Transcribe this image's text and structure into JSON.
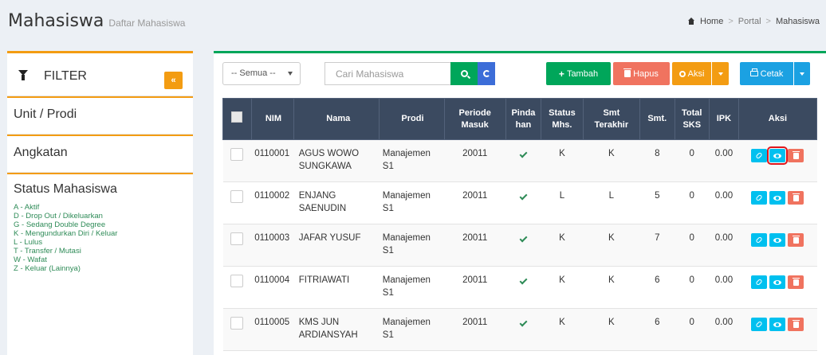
{
  "header": {
    "title": "Mahasiswa",
    "subtitle": "Daftar Mahasiswa"
  },
  "breadcrumb": [
    "Home",
    "Portal",
    "Mahasiswa"
  ],
  "filter": {
    "title": "FILTER",
    "collapse_label": "«",
    "items": [
      "Unit / Prodi",
      "Angkatan"
    ],
    "status_title": "Status Mahasiswa",
    "status_list": [
      "A - Aktif",
      "D - Drop Out / Dikeluarkan",
      "G - Sedang Double Degree",
      "K - Mengundurkan Diri / Keluar",
      "L - Lulus",
      "T - Transfer / Mutasi",
      "W - Wafat",
      "Z - Keluar (Lainnya)"
    ]
  },
  "toolbar": {
    "select_value": "-- Semua --",
    "search_placeholder": "Cari Mahasiswa",
    "tambah_label": "Tambah",
    "hapus_label": "Hapus",
    "aksi_label": "Aksi",
    "cetak_label": "Cetak"
  },
  "table": {
    "headers": {
      "nim": "NIM",
      "nama": "Nama",
      "prodi": "Prodi",
      "periode_1": "Periode",
      "periode_2": "Masuk",
      "pindahan_1": "Pinda",
      "pindahan_2": "han",
      "status_1": "Status",
      "status_2": "Mhs.",
      "smt_terakhir_1": "Smt",
      "smt_terakhir_2": "Terakhir",
      "smt": "Smt.",
      "total_sks_1": "Total",
      "total_sks_2": "SKS",
      "ipk": "IPK",
      "aksi": "Aksi"
    },
    "rows": [
      {
        "nim": "0110001",
        "nama_1": "AGUS WOWO",
        "nama_2": "SUNGKAWA",
        "prodi_1": "Manajemen",
        "prodi_2": "S1",
        "periode": "20011",
        "status": "K",
        "smt_terakhir": "K",
        "smt": "8",
        "sks": "0",
        "ipk": "0.00"
      },
      {
        "nim": "0110002",
        "nama_1": "ENJANG",
        "nama_2": "SAENUDIN",
        "prodi_1": "Manajemen",
        "prodi_2": "S1",
        "periode": "20011",
        "status": "L",
        "smt_terakhir": "L",
        "smt": "5",
        "sks": "0",
        "ipk": "0.00"
      },
      {
        "nim": "0110003",
        "nama_1": "JAFAR YUSUF",
        "nama_2": "",
        "prodi_1": "Manajemen",
        "prodi_2": "S1",
        "periode": "20011",
        "status": "K",
        "smt_terakhir": "K",
        "smt": "7",
        "sks": "0",
        "ipk": "0.00"
      },
      {
        "nim": "0110004",
        "nama_1": "FITRIAWATI",
        "nama_2": "",
        "prodi_1": "Manajemen",
        "prodi_2": "S1",
        "periode": "20011",
        "status": "K",
        "smt_terakhir": "K",
        "smt": "6",
        "sks": "0",
        "ipk": "0.00"
      },
      {
        "nim": "0110005",
        "nama_1": "KMS JUN",
        "nama_2": "ARDIANSYAH",
        "prodi_1": "Manajemen",
        "prodi_2": "S1",
        "periode": "20011",
        "status": "K",
        "smt_terakhir": "K",
        "smt": "6",
        "sks": "0",
        "ipk": "0.00"
      }
    ]
  },
  "colors": {
    "orange": "#f39c12",
    "green": "#00a65a",
    "navy": "#3b4a60",
    "cyan": "#00c0ef",
    "red": "#f0735f",
    "highlight": "#e0161c"
  },
  "icons": [
    "home-icon",
    "funnel-icon",
    "search-icon",
    "refresh-icon",
    "plus-icon",
    "trash-icon",
    "gear-icon",
    "print-icon",
    "link-icon",
    "eye-icon",
    "check-icon"
  ]
}
